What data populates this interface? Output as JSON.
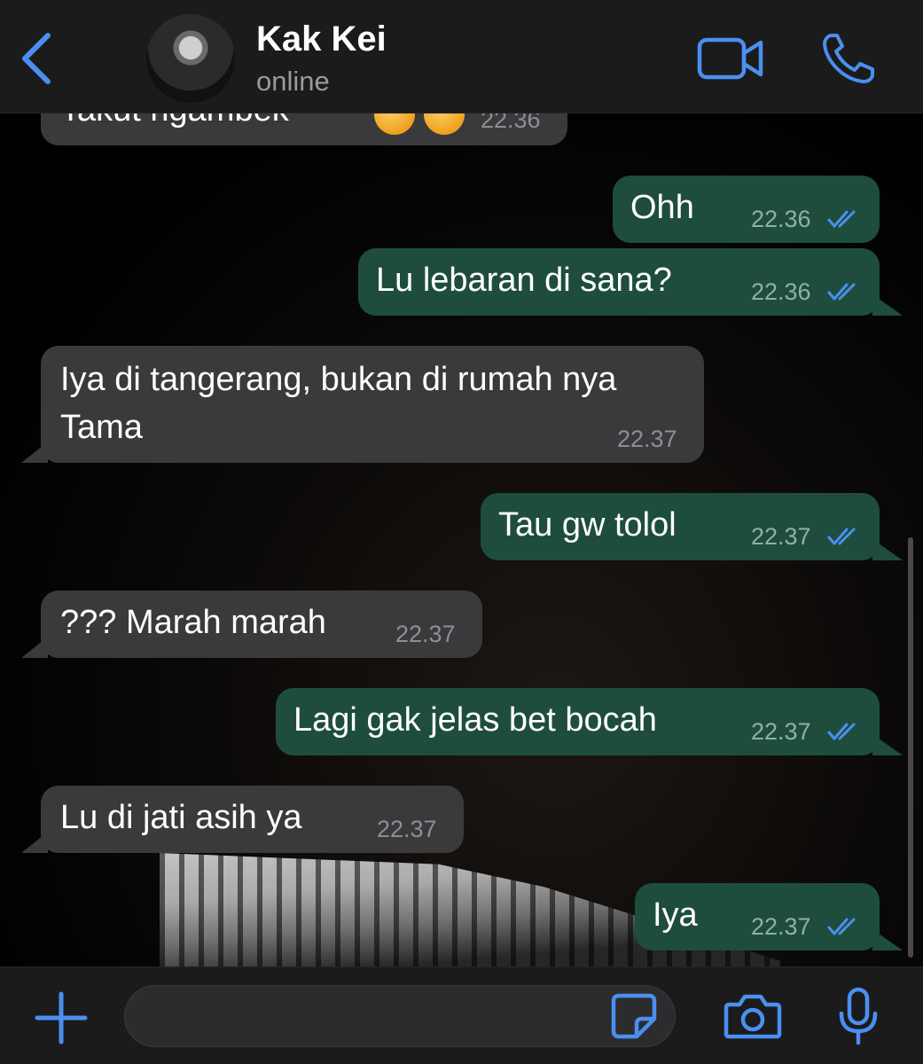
{
  "header": {
    "contact_name": "Kak Kei",
    "status": "online"
  },
  "colors": {
    "accent": "#4b8ff0",
    "incoming_bubble": "#3a3a3c",
    "outgoing_bubble": "#1e4d3d",
    "read_tick": "#4b8ff0"
  },
  "messages": [
    {
      "direction": "in",
      "text": "Takut ngambek",
      "emoji": [
        "pouting-face",
        "pouting-face"
      ],
      "time": "22.36"
    },
    {
      "direction": "out",
      "text": "Ohh",
      "time": "22.36",
      "status": "read"
    },
    {
      "direction": "out",
      "text": "Lu lebaran di sana?",
      "time": "22.36",
      "status": "read"
    },
    {
      "direction": "in",
      "text_line1": "Iya di tangerang, bukan di rumah nya",
      "text_line2": "Tama",
      "time": "22.37"
    },
    {
      "direction": "out",
      "text": "Tau gw tolol",
      "time": "22.37",
      "status": "read"
    },
    {
      "direction": "in",
      "text": "??? Marah marah",
      "time": "22.37"
    },
    {
      "direction": "out",
      "text": "Lagi gak jelas bet bocah",
      "time": "22.37",
      "status": "read"
    },
    {
      "direction": "in",
      "text": "Lu di jati asih ya",
      "time": "22.37"
    },
    {
      "direction": "out",
      "text": "Iya",
      "time": "22.37",
      "status": "read"
    }
  ],
  "input": {
    "value": "",
    "placeholder": ""
  },
  "icons": {
    "back": "chevron-left-icon",
    "video": "video-camera-icon",
    "call": "phone-icon",
    "attach": "plus-icon",
    "sticker": "sticker-icon",
    "camera": "camera-icon",
    "mic": "microphone-icon"
  }
}
